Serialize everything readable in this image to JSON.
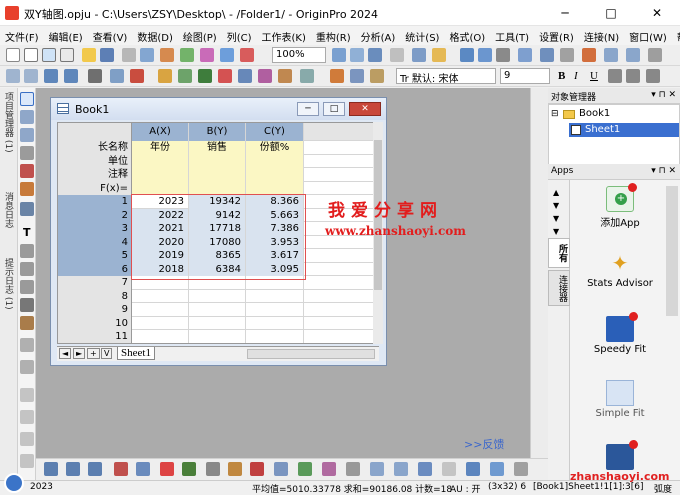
{
  "window": {
    "title": "双Y轴图.opju - C:\\Users\\ZSY\\Desktop\\ - /Folder1/ - OriginPro 2024",
    "minimize_glyph": "─",
    "maximize_glyph": "□",
    "close_glyph": "✕"
  },
  "menu": [
    "文件(F)",
    "编辑(E)",
    "查看(V)",
    "数据(D)",
    "绘图(P)",
    "列(C)",
    "工作表(K)",
    "重构(R)",
    "分析(A)",
    "统计(S)",
    "格式(O)",
    "工具(T)",
    "设置(R)",
    "连接(N)",
    "窗口(W)",
    "帮助(H)"
  ],
  "toolbar": {
    "zoom": "100%",
    "font_name": "Tr 默认: 宋体",
    "font_size": "9",
    "bold": "B",
    "italic": "I",
    "underline": "U"
  },
  "left_dock": {
    "tab1": "项目管理器 (1)",
    "tab2": "消息日志",
    "tab3": "提示日志 (1)"
  },
  "book": {
    "title": "Book1",
    "columns": [
      "A(X)",
      "B(Y)",
      "C(Y)"
    ],
    "meta_rows": [
      {
        "label": "长名称",
        "values": [
          "年份",
          "销售",
          "份额%"
        ]
      },
      {
        "label": "单位",
        "values": [
          "",
          "",
          ""
        ]
      },
      {
        "label": "注释",
        "values": [
          "",
          "",
          ""
        ]
      },
      {
        "label": "F(x)=",
        "values": [
          "",
          "",
          ""
        ]
      }
    ],
    "rows": [
      {
        "n": "1",
        "a": "2023",
        "b": "19342",
        "c": "8.366"
      },
      {
        "n": "2",
        "a": "2022",
        "b": "9142",
        "c": "5.663"
      },
      {
        "n": "3",
        "a": "2021",
        "b": "17718",
        "c": "7.386"
      },
      {
        "n": "4",
        "a": "2020",
        "b": "17080",
        "c": "3.953"
      },
      {
        "n": "5",
        "a": "2019",
        "b": "8365",
        "c": "3.617"
      },
      {
        "n": "6",
        "a": "2018",
        "b": "6384",
        "c": "3.095"
      },
      {
        "n": "7",
        "a": "",
        "b": "",
        "c": ""
      },
      {
        "n": "8",
        "a": "",
        "b": "",
        "c": ""
      },
      {
        "n": "9",
        "a": "",
        "b": "",
        "c": ""
      },
      {
        "n": "10",
        "a": "",
        "b": "",
        "c": ""
      },
      {
        "n": "11",
        "a": "",
        "b": "",
        "c": ""
      }
    ],
    "sheet_tab": "Sheet1",
    "nav": [
      "◄",
      "►",
      "+",
      "V"
    ]
  },
  "watermark": {
    "cn": "我爱分享网",
    "url": "www.zhanshaoyi.com"
  },
  "object_manager": {
    "title": "对象管理器",
    "book": "Book1",
    "sheet": "Sheet1"
  },
  "apps": {
    "title": "Apps",
    "tab_all": "所有",
    "tab_connect": "连接器",
    "items": [
      "添加App",
      "Stats Advisor",
      "Speedy Fit",
      "Simple Fit"
    ]
  },
  "feedback": ">>反馈",
  "status": {
    "left": "2023",
    "stats": "平均值=5010.33778 求和=90186.08 计数=18",
    "au": "AU : 开",
    "dims": "(3x32) 6",
    "sheet": "[Book1]Sheet1!1[1]:3[6]",
    "angle": "弧度"
  },
  "watermark_bottom": "zhanshaoyi.com",
  "colors": {
    "selected_header": "#9bb3d1",
    "meta_row_bg": "#fbf7c4",
    "watermark": "#e21d1d"
  }
}
